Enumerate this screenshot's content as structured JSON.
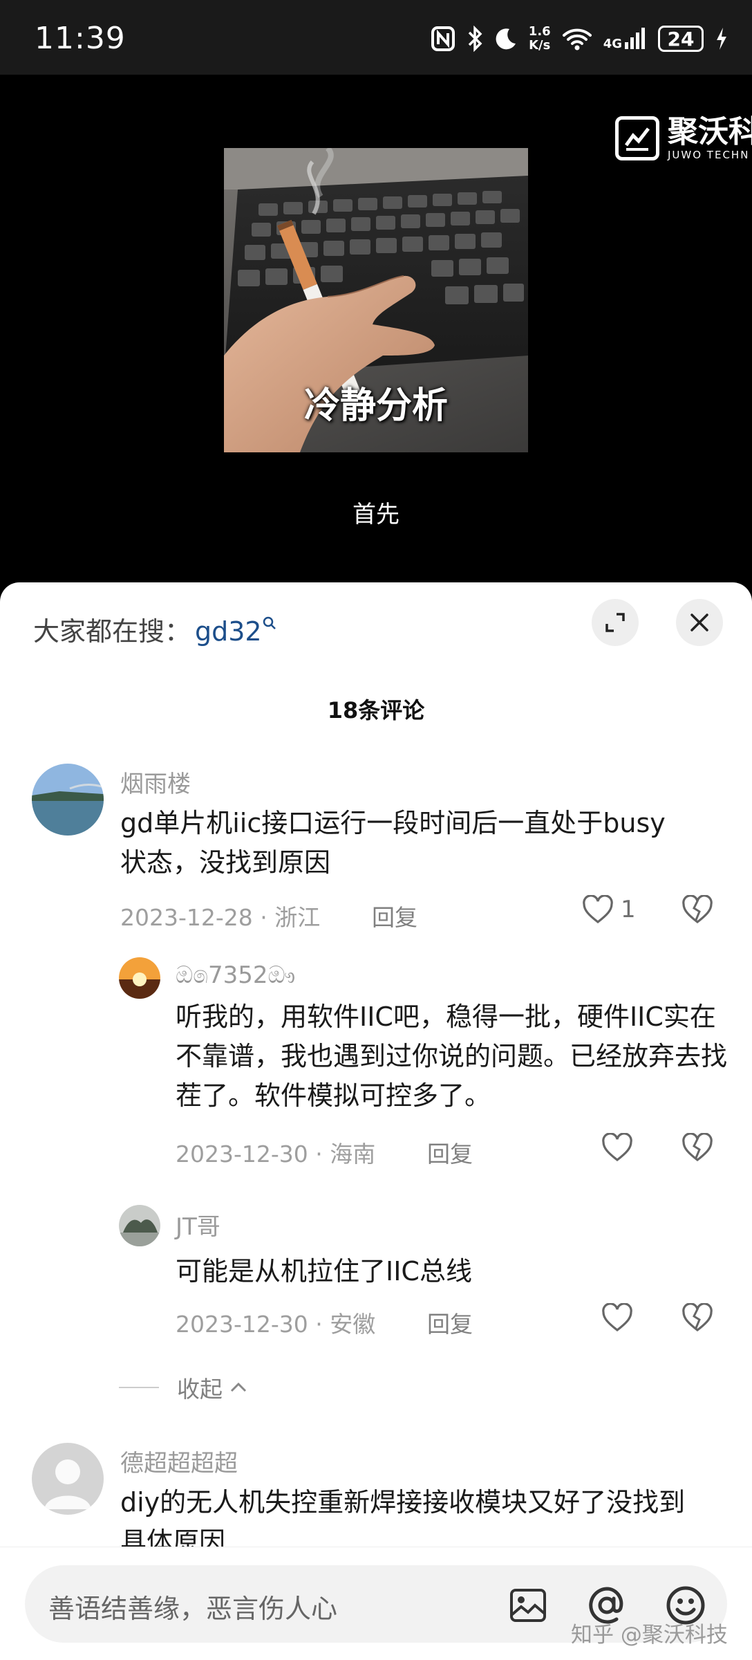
{
  "status_bar": {
    "time": "11:39",
    "net_speed_value": "1.6",
    "net_speed_unit": "K/s",
    "network_type": "4G",
    "battery": "24",
    "icons": [
      "nfc-icon",
      "bluetooth-icon",
      "moon-icon",
      "wifi-icon",
      "signal-icon",
      "battery-icon",
      "charging-icon"
    ]
  },
  "video": {
    "logo_cn": "聚沃科",
    "logo_en": "JUWO TECHN",
    "meme_caption": "冷静分析",
    "subtitle": "首先"
  },
  "sheet": {
    "search_prefix": "大家都在搜：",
    "search_keyword": "gd32",
    "comment_count": "18条评论",
    "collapse_label": "收起"
  },
  "comments": [
    {
      "name": "烟雨楼",
      "text": "gd单片机iic接口运行一段时间后一直处于busy状态，没找到原因",
      "date": "2023-12-28",
      "location": "浙江",
      "reply_label": "回复",
      "likes": "1"
    },
    {
      "name": "ඔ෧7352ඖ",
      "text": "听我的，用软件IIC吧，稳得一批，硬件IIC实在不靠谱，我也遇到过你说的问题。已经放弃去找茬了。软件模拟可控多了。",
      "date": "2023-12-30",
      "location": "海南",
      "reply_label": "回复"
    },
    {
      "name": "JT哥",
      "text": "可能是从机拉住了IIC总线",
      "date": "2023-12-30",
      "location": "安徽",
      "reply_label": "回复"
    },
    {
      "name": "德超超超超",
      "text": "diy的无人机失控重新焊接接收模块又好了没找到具体原因"
    }
  ],
  "input": {
    "placeholder": "善语结善缘，恶言伤人心"
  },
  "watermark": "知乎 @聚沃科技",
  "colors": {
    "keyword": "#1c4e8a",
    "meta_gray": "#9e9e9e",
    "sheet_bg": "#ffffff"
  }
}
